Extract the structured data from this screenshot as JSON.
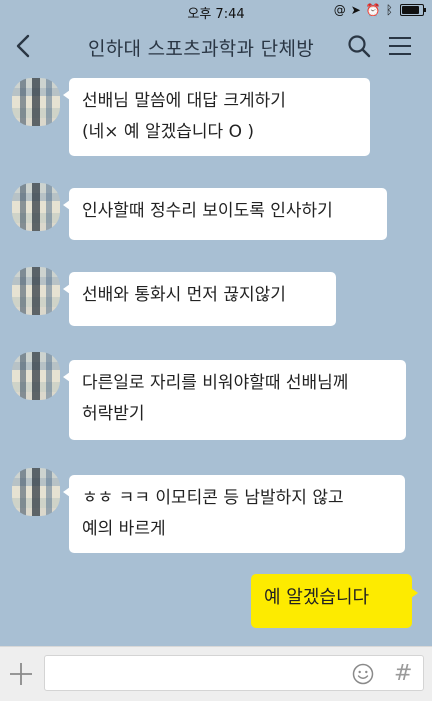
{
  "status_bar": {
    "time": "오후 7:44",
    "icons": [
      "at-sign-icon",
      "location-arrow-icon",
      "alarm-icon",
      "bluetooth-icon",
      "battery-icon"
    ]
  },
  "header": {
    "title": "인하대 스포츠과학과 단체방",
    "icons": [
      "back-arrow-icon",
      "search-icon",
      "menu-icon"
    ]
  },
  "messages": [
    {
      "side": "received",
      "lines": [
        "선배님 말씀에 대답 크게하기",
        "(네× 예 알겠습니다 O )"
      ]
    },
    {
      "side": "received",
      "lines": [
        "인사할때 정수리 보이도록 인사하기"
      ]
    },
    {
      "side": "received",
      "lines": [
        "선배와 통화시 먼저 끊지않기"
      ]
    },
    {
      "side": "received",
      "lines": [
        "다른일로 자리를 비워야할때 선배님께",
        "허락받기"
      ]
    },
    {
      "side": "received",
      "lines": [
        "ㅎㅎ ㅋㅋ 이모티콘 등 남발하지 않고",
        "예의 바르게"
      ]
    },
    {
      "side": "sent",
      "lines": [
        "예 알겠습니다"
      ]
    }
  ],
  "input_bar": {
    "value": "",
    "icons": [
      "plus-icon",
      "emoji-icon",
      "hashtag-icon"
    ],
    "hash_symbol": "#"
  },
  "colors": {
    "background": "#a8bfd3",
    "received_bubble": "#ffffff",
    "sent_bubble": "#fdeb00"
  }
}
